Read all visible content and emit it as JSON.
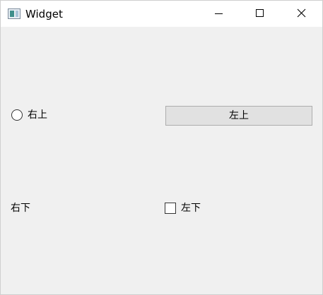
{
  "window": {
    "title": "Widget"
  },
  "titlebar": {
    "icon": "app-window-icon",
    "controls": [
      "minimize-icon",
      "maximize-icon",
      "close-icon"
    ]
  },
  "widgets": {
    "radio_label": "右上",
    "radio_checked": false,
    "button_label": "左上",
    "static_label": "右下",
    "checkbox_label": "左下",
    "checkbox_checked": false
  },
  "colors": {
    "client_background": "#f0f0f0",
    "titlebar_background": "#ffffff",
    "button_background": "#e1e1e1",
    "button_border": "#adadad"
  }
}
